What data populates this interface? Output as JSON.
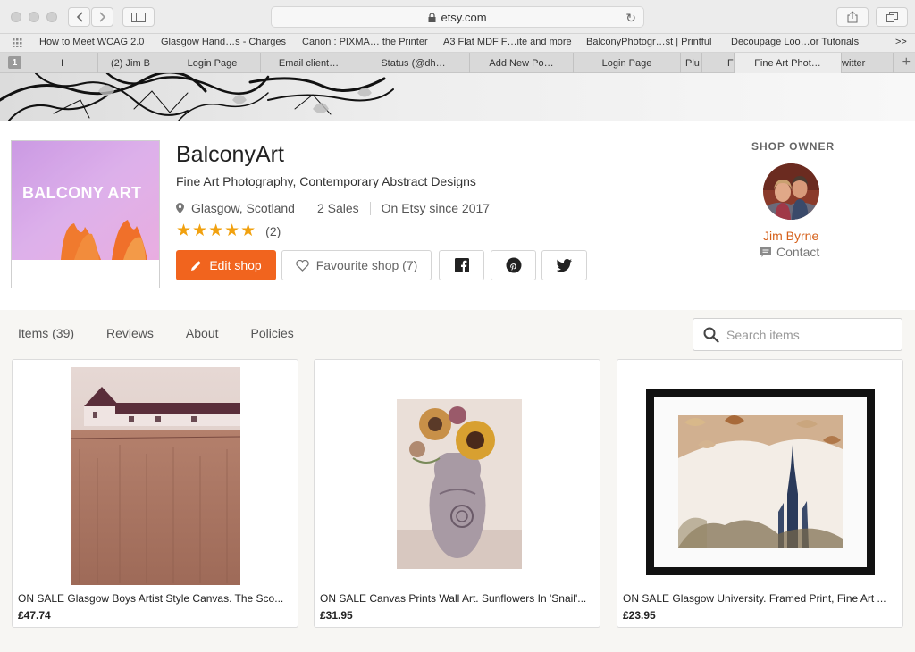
{
  "browser": {
    "url": "etsy.com",
    "bookmarks": [
      "How to Meet WCAG 2.0",
      "Glasgow Hand…s - Charges",
      "Canon : PIXMA… the Printer",
      "A3 Flat MDF F…ite and more",
      "BalconyPhotogr…st | Printful",
      "Decoupage Loo…or Tutorials"
    ],
    "bookmarks_more": ">>",
    "tab_number": "1",
    "tabs": [
      "I",
      "(2) Jim B",
      "Login Page",
      "Email client…",
      "Status (@dh…",
      "Add New Po…",
      "Login Page",
      "Plu",
      "Fi",
      "Fine Art Phot…",
      "witter"
    ]
  },
  "shop": {
    "logo_text": "BALCONY ART",
    "name": "BalconyArt",
    "tagline": "Fine Art Photography, Contemporary Abstract Designs",
    "location": "Glasgow, Scotland",
    "sales": "2 Sales",
    "since": "On Etsy since 2017",
    "stars": "★★★★★",
    "review_count": "(2)",
    "rating_value": 5,
    "edit_label": "Edit shop",
    "favourite_label": "Favourite shop (7)"
  },
  "owner": {
    "label": "SHOP OWNER",
    "name": "Jim Byrne",
    "contact": "Contact"
  },
  "tabs": [
    "Items (39)",
    "Reviews",
    "About",
    "Policies"
  ],
  "search": {
    "placeholder": "Search items"
  },
  "listings": [
    {
      "title": "ON SALE Glasgow Boys Artist Style Canvas. The Sco...",
      "price": "£47.74"
    },
    {
      "title": "ON SALE Canvas Prints Wall Art. Sunflowers In 'Snail'...",
      "price": "£31.95"
    },
    {
      "title": "ON SALE Glasgow University. Framed Print, Fine Art ...",
      "price": "£23.95"
    }
  ],
  "colors": {
    "accent": "#f1641e",
    "owner_link": "#d5601a",
    "stars": "#f1a10f",
    "listings_bg": "#f7f6f3"
  },
  "icons": [
    "back-icon",
    "forward-icon",
    "sidebar-icon",
    "lock-icon",
    "reload-icon",
    "share-icon",
    "tabs-icon",
    "bookmarks-grid-icon",
    "location-pin-icon",
    "pencil-icon",
    "heart-icon",
    "facebook-icon",
    "pinterest-icon",
    "twitter-icon",
    "message-icon",
    "search-icon"
  ]
}
